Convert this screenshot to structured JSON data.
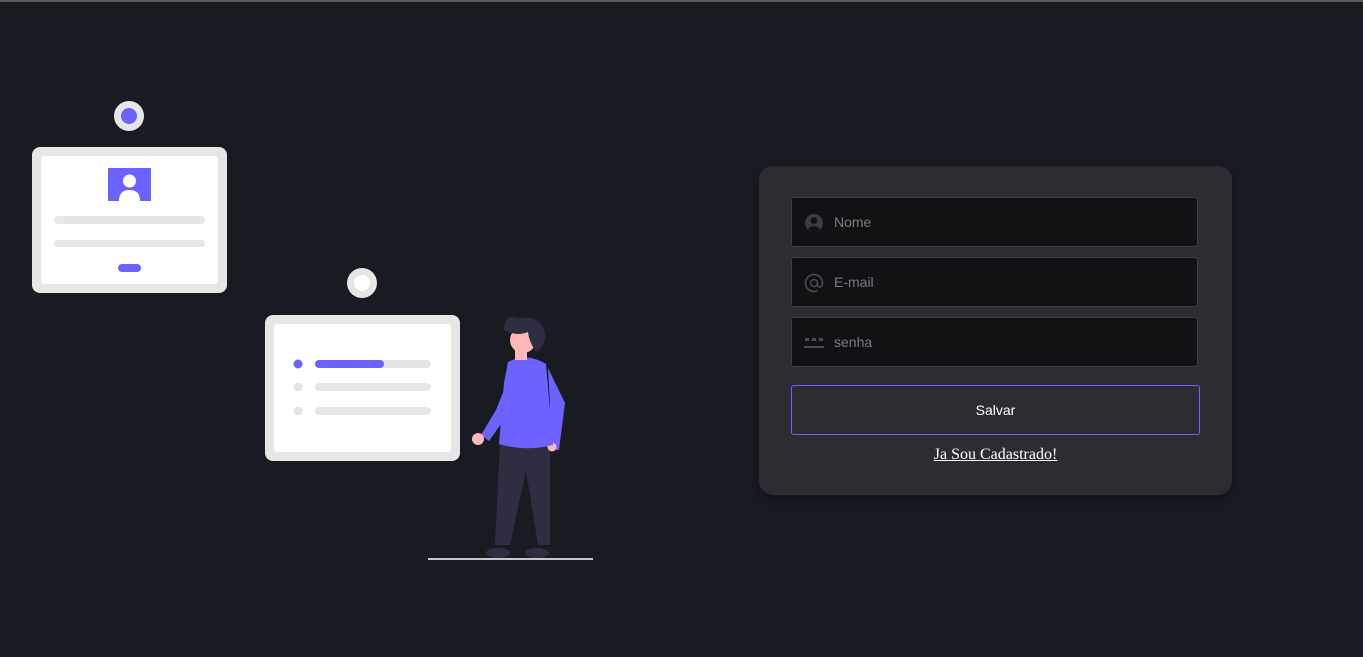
{
  "form": {
    "name_placeholder": "Nome",
    "email_placeholder": "E-mail",
    "password_placeholder": "senha",
    "save_label": "Salvar",
    "login_link": "Ja Sou Cadastrado!"
  },
  "icons": {
    "name": "user-icon",
    "email": "at-sign-icon",
    "password": "password-dots-icon"
  },
  "colors": {
    "background": "#191b23",
    "card": "#2d2c33",
    "input": "#121215",
    "accent": "#6c63ff",
    "skin": "#ffb8b8",
    "hair": "#2f2e41"
  }
}
